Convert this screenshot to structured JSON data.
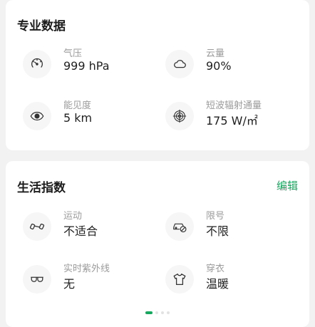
{
  "pro": {
    "title": "专业数据",
    "items": [
      {
        "label": "气压",
        "value": "999 hPa",
        "icon": "pressure-gauge-icon"
      },
      {
        "label": "云量",
        "value": "90%",
        "icon": "cloud-icon"
      },
      {
        "label": "能见度",
        "value": "5 km",
        "icon": "eye-icon"
      },
      {
        "label": "短波辐射通量",
        "value": "175 W/㎡",
        "icon": "radiation-target-icon"
      }
    ]
  },
  "life": {
    "title": "生活指数",
    "edit_label": "编辑",
    "items": [
      {
        "label": "运动",
        "value": "不适合",
        "icon": "dumbbell-icon"
      },
      {
        "label": "限号",
        "value": "不限",
        "icon": "car-restriction-icon"
      },
      {
        "label": "实时紫外线",
        "value": "无",
        "icon": "sunglasses-icon"
      },
      {
        "label": "穿衣",
        "value": "温暖",
        "icon": "tshirt-icon"
      }
    ],
    "pager": {
      "count": 4,
      "active_index": 0
    }
  },
  "colors": {
    "accent": "#17a85f",
    "card": "#ffffff",
    "background": "#f2f2f2",
    "label": "#9b9b9b",
    "value": "#1f1f1f"
  }
}
